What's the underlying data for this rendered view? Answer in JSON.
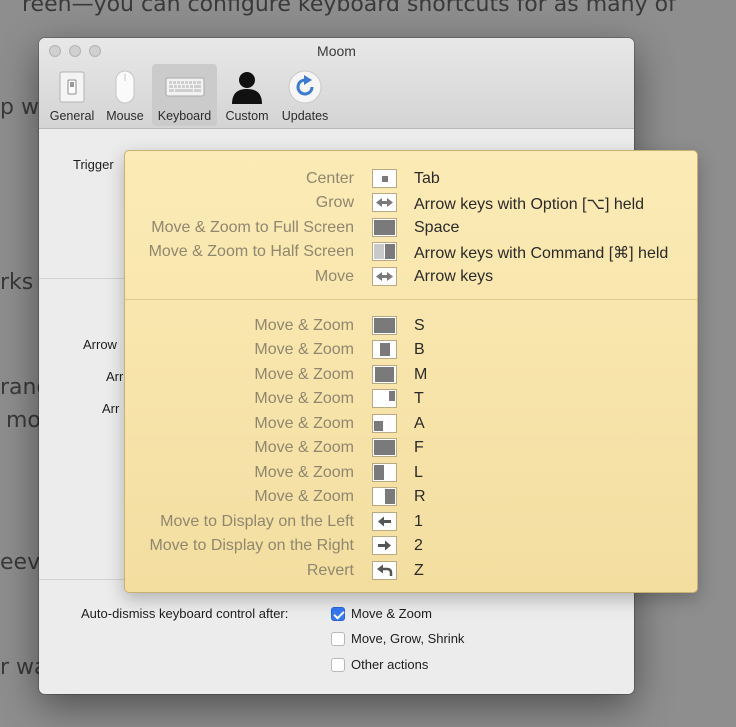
{
  "background_text": {
    "line1": "reen—you can configure keyboard shortcuts for as many of",
    "frag1": "p w",
    "frag2": "rks e",
    "frag3": "rang",
    "frag4": "mo",
    "frag5": "eev",
    "frag6": "r wa"
  },
  "window": {
    "title": "Moom",
    "toolbar": [
      {
        "label": "General",
        "icon": "switch-icon"
      },
      {
        "label": "Mouse",
        "icon": "mouse-icon"
      },
      {
        "label": "Keyboard",
        "icon": "keyboard-icon",
        "selected": true
      },
      {
        "label": "Custom",
        "icon": "person-icon"
      },
      {
        "label": "Updates",
        "icon": "refresh-icon"
      }
    ],
    "trigger_label": "Trigger",
    "arrow_label_1": "Arrow",
    "arrow_label_2": "Arr",
    "arrow_label_3": "Arr",
    "auto_dismiss": {
      "label": "Auto-dismiss keyboard control after:",
      "options": [
        {
          "label": "Move & Zoom",
          "checked": true
        },
        {
          "label": "Move, Grow, Shrink",
          "checked": false
        },
        {
          "label": "Other actions",
          "checked": false
        }
      ]
    }
  },
  "hud": {
    "top_rows": [
      {
        "action": "Center",
        "key": "Tab",
        "icon": "center-icon"
      },
      {
        "action": "Grow",
        "key": "Arrow keys with Option [⌥] held",
        "icon": "grow-arrows-icon"
      },
      {
        "action": "Move & Zoom to Full Screen",
        "key": "Space",
        "icon": "full-screen-icon"
      },
      {
        "action": "Move & Zoom to Half Screen",
        "key": "Arrow keys with Command [⌘] held",
        "icon": "half-screen-icon"
      },
      {
        "action": "Move",
        "key": "Arrow keys",
        "icon": "move-arrows-icon"
      }
    ],
    "bottom_rows": [
      {
        "action": "Move & Zoom",
        "key": "S",
        "icon": "zoom-full-icon"
      },
      {
        "action": "Move & Zoom",
        "key": "B",
        "icon": "zoom-center-icon"
      },
      {
        "action": "Move & Zoom",
        "key": "M",
        "icon": "zoom-large-icon"
      },
      {
        "action": "Move & Zoom",
        "key": "T",
        "icon": "zoom-top-right-icon"
      },
      {
        "action": "Move & Zoom",
        "key": "A",
        "icon": "zoom-bottom-left-icon"
      },
      {
        "action": "Move & Zoom",
        "key": "F",
        "icon": "zoom-full-icon"
      },
      {
        "action": "Move & Zoom",
        "key": "L",
        "icon": "zoom-left-icon"
      },
      {
        "action": "Move & Zoom",
        "key": "R",
        "icon": "zoom-right-icon"
      },
      {
        "action": "Move to Display on the Left",
        "key": "1",
        "icon": "arrow-left-icon"
      },
      {
        "action": "Move to Display on the Right",
        "key": "2",
        "icon": "arrow-right-icon"
      },
      {
        "action": "Revert",
        "key": "Z",
        "icon": "revert-icon"
      }
    ]
  }
}
